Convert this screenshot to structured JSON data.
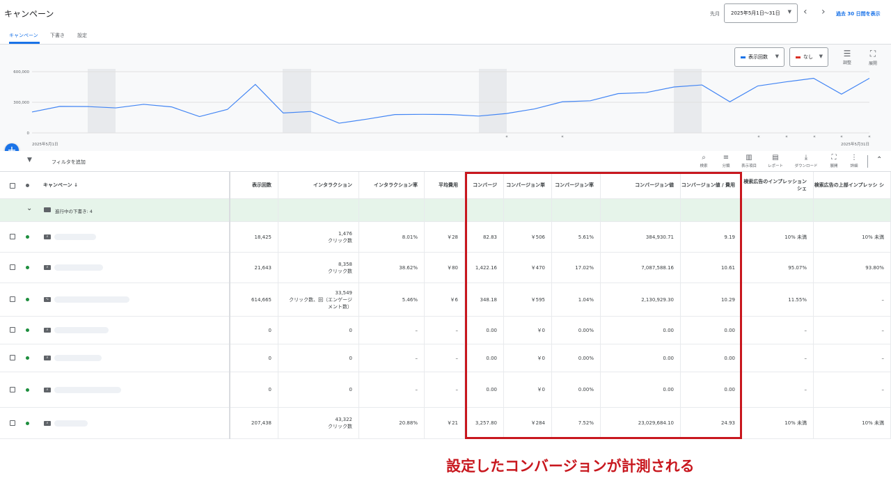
{
  "header": {
    "title": "キャンペーン",
    "period_label": "先月",
    "date_range": "2025年5月1日～31日",
    "quick_range": "過去 30 日間を表示"
  },
  "tabs": [
    {
      "label": "キャンペーン",
      "active": true
    },
    {
      "label": "下書き",
      "active": false
    },
    {
      "label": "設定",
      "active": false
    }
  ],
  "chart_controls": {
    "metric1": "表示回数",
    "metric1_color": "#1a73e8",
    "metric2": "なし",
    "metric2_color": "#d93025",
    "adjust_label": "調整",
    "expand_label": "展開"
  },
  "chart_data": {
    "type": "line",
    "x_start_label": "2025年5月1日",
    "x_end_label": "2025年5月31日",
    "y_ticks": [
      "600,000",
      "300,000",
      "0"
    ],
    "ylim": [
      0,
      600000
    ],
    "series": [
      {
        "values": [
          205000,
          260000,
          258000,
          245000,
          280000,
          255000,
          160000,
          230000,
          475000,
          195000,
          210000,
          95000,
          135000,
          180000,
          182000,
          180000,
          165000,
          190000,
          235000,
          305000,
          315000,
          385000,
          395000,
          450000,
          470000,
          305000,
          460000,
          500000,
          535000,
          380000,
          535000
        ]
      }
    ],
    "grid": true,
    "color": "#4285f4"
  },
  "toolbar": {
    "filter_label": "フィルタを追加",
    "buttons": [
      {
        "icon": "search-icon",
        "label": "検索"
      },
      {
        "icon": "segment-icon",
        "label": "分類"
      },
      {
        "icon": "columns-icon",
        "label": "表示項目"
      },
      {
        "icon": "report-icon",
        "label": "レポート"
      },
      {
        "icon": "download-icon",
        "label": "ダウンロード"
      },
      {
        "icon": "expand-icon",
        "label": "展開"
      },
      {
        "icon": "more-icon",
        "label": "詳細"
      }
    ]
  },
  "table": {
    "columns": [
      "キャンペーン ↓",
      "表示回数",
      "インタラクション",
      "インタラクション率",
      "平均費用",
      "コンバージ",
      "コンバージョン単",
      "コンバージョン率",
      "コンバージョン値",
      "コンバージョン値 / 費用",
      "検索広告のインプレッション シェ",
      "検索広告の上部インプレッシ シ"
    ],
    "group_row": "進行中の下書き: 4",
    "rows": [
      {
        "impressions": "18,425",
        "interactions": "1,476",
        "interaction_type": "クリック数",
        "rate": "8.01%",
        "avg_cost": "￥28",
        "conv": "82.83",
        "cost_per_conv": "￥506",
        "conv_rate": "5.61%",
        "conv_value": "384,930.71",
        "value_cost": "9.19",
        "is1": "10% 未満",
        "is2": "10% 未満"
      },
      {
        "impressions": "21,643",
        "interactions": "8,358",
        "interaction_type": "クリック数",
        "rate": "38.62%",
        "avg_cost": "￥80",
        "conv": "1,422.16",
        "cost_per_conv": "￥470",
        "conv_rate": "17.02%",
        "conv_value": "7,087,588.16",
        "value_cost": "10.61",
        "is1": "95.07%",
        "is2": "93.80%"
      },
      {
        "impressions": "614,665",
        "interactions": "33,549",
        "interaction_type": "クリック数、回（エンゲージ メント数）",
        "rate": "5.46%",
        "avg_cost": "￥6",
        "conv": "348.18",
        "cost_per_conv": "￥595",
        "conv_rate": "1.04%",
        "conv_value": "2,130,929.30",
        "value_cost": "10.29",
        "is1": "11.55%",
        "is2": "–"
      },
      {
        "impressions": "0",
        "interactions": "0",
        "interaction_type": "",
        "rate": "–",
        "avg_cost": "–",
        "conv": "0.00",
        "cost_per_conv": "￥0",
        "conv_rate": "0.00%",
        "conv_value": "0.00",
        "value_cost": "0.00",
        "is1": "–",
        "is2": "–"
      },
      {
        "impressions": "0",
        "interactions": "0",
        "interaction_type": "",
        "rate": "–",
        "avg_cost": "–",
        "conv": "0.00",
        "cost_per_conv": "￥0",
        "conv_rate": "0.00%",
        "conv_value": "0.00",
        "value_cost": "0.00",
        "is1": "–",
        "is2": "–"
      },
      {
        "impressions": "0",
        "interactions": "0",
        "interaction_type": "",
        "rate": "–",
        "avg_cost": "–",
        "conv": "0.00",
        "cost_per_conv": "￥0",
        "conv_rate": "0.00%",
        "conv_value": "0.00",
        "value_cost": "0.00",
        "is1": "–",
        "is2": "–"
      },
      {
        "impressions": "207,438",
        "interactions": "43,322",
        "interaction_type": "クリック数",
        "rate": "20.88%",
        "avg_cost": "￥21",
        "conv": "3,257.80",
        "cost_per_conv": "￥284",
        "conv_rate": "7.52%",
        "conv_value": "23,029,684.10",
        "value_cost": "24.93",
        "is1": "10% 未満",
        "is2": "10% 未満"
      }
    ]
  },
  "caption": "設定したコンバージョンが計測される"
}
